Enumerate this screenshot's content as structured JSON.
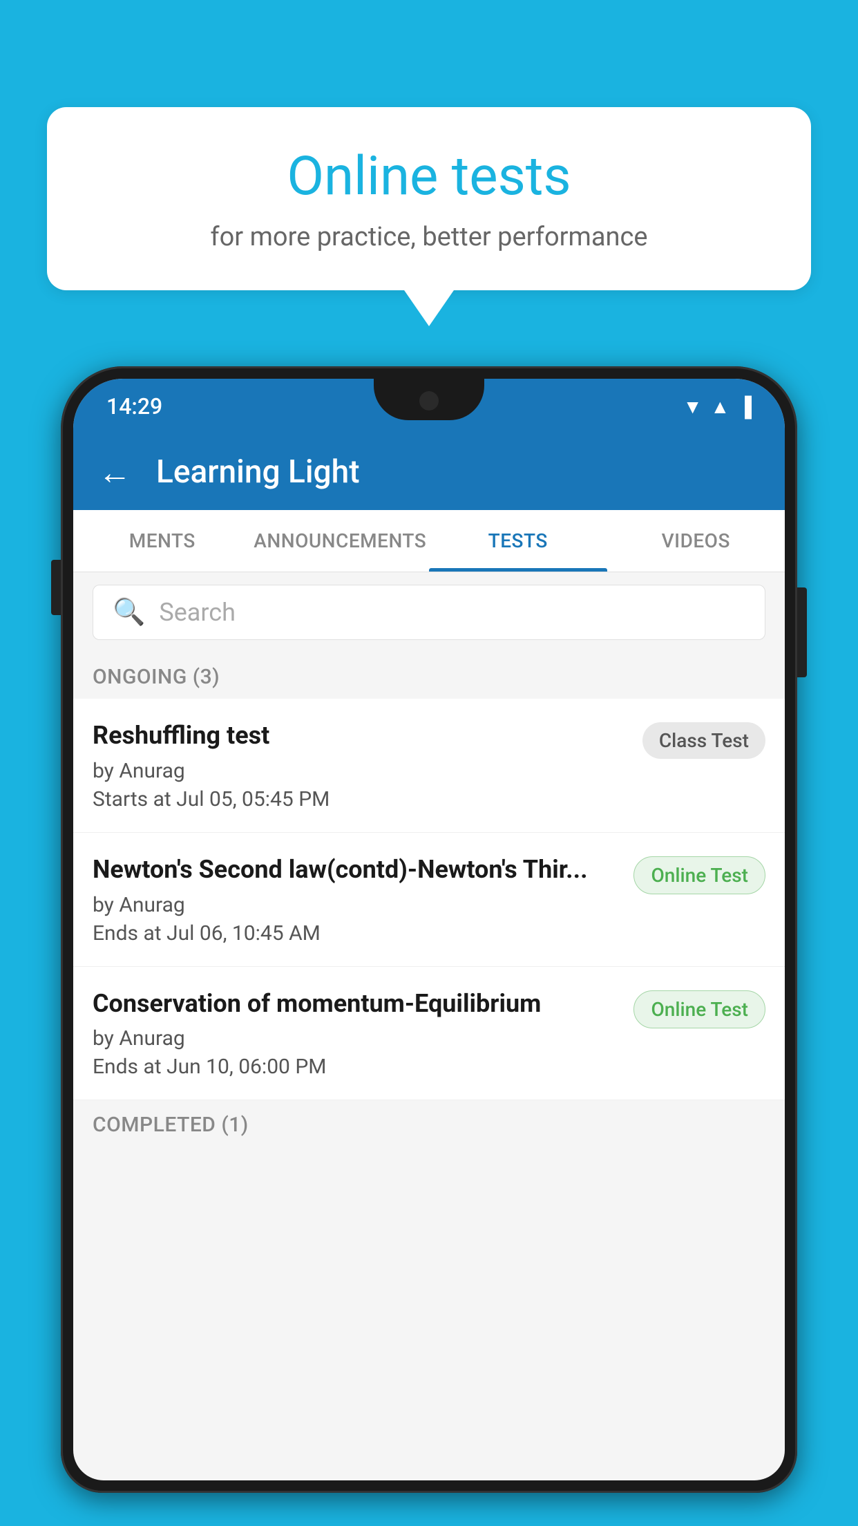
{
  "background_color": "#1ab3e0",
  "speech_bubble": {
    "title": "Online tests",
    "subtitle": "for more practice, better performance"
  },
  "phone": {
    "status_bar": {
      "time": "14:29"
    },
    "header": {
      "back_label": "←",
      "title": "Learning Light"
    },
    "tabs": [
      {
        "id": "ments",
        "label": "MENTS",
        "active": false
      },
      {
        "id": "announcements",
        "label": "ANNOUNCEMENTS",
        "active": false
      },
      {
        "id": "tests",
        "label": "TESTS",
        "active": true
      },
      {
        "id": "videos",
        "label": "VIDEOS",
        "active": false
      }
    ],
    "search": {
      "placeholder": "Search"
    },
    "ongoing_section": {
      "label": "ONGOING (3)"
    },
    "tests": [
      {
        "id": "test-1",
        "name": "Reshuffling test",
        "author": "by Anurag",
        "date": "Starts at  Jul 05, 05:45 PM",
        "badge": "Class Test",
        "badge_type": "class"
      },
      {
        "id": "test-2",
        "name": "Newton's Second law(contd)-Newton's Thir...",
        "author": "by Anurag",
        "date": "Ends at  Jul 06, 10:45 AM",
        "badge": "Online Test",
        "badge_type": "online"
      },
      {
        "id": "test-3",
        "name": "Conservation of momentum-Equilibrium",
        "author": "by Anurag",
        "date": "Ends at  Jun 10, 06:00 PM",
        "badge": "Online Test",
        "badge_type": "online"
      }
    ],
    "completed_section": {
      "label": "COMPLETED (1)"
    }
  }
}
